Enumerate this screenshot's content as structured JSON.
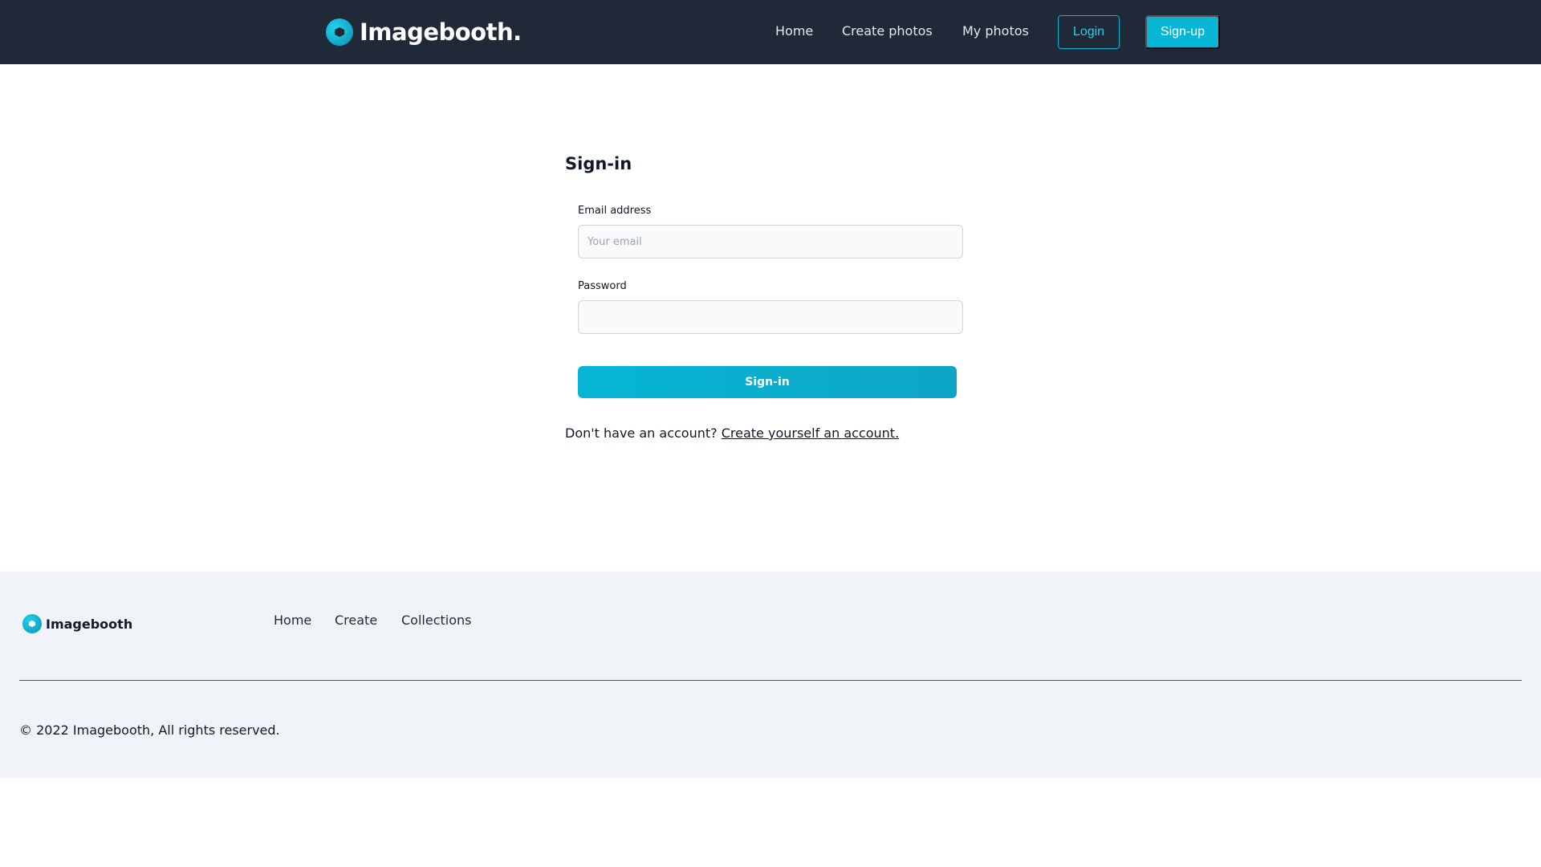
{
  "header": {
    "brand": "Imagebooth.",
    "nav": [
      "Home",
      "Create photos",
      "My photos"
    ],
    "login_label": "Login",
    "signup_label": "Sign-up"
  },
  "form": {
    "title": "Sign-in",
    "email_label": "Email address",
    "email_placeholder": "Your email",
    "email_value": "",
    "password_label": "Password",
    "password_value": "",
    "submit_label": "Sign-in",
    "no_account_text": "Don't have an account?",
    "create_account_link": "Create yourself an account."
  },
  "footer": {
    "brand": "Imagebooth",
    "links": [
      "Home",
      "Create",
      "Collections"
    ],
    "copyright": "© 2022 Imagebooth, All rights reserved."
  },
  "colors": {
    "header_bg": "#1f2937",
    "accent": "#06b6d4",
    "footer_bg": "#f0f4f8"
  }
}
